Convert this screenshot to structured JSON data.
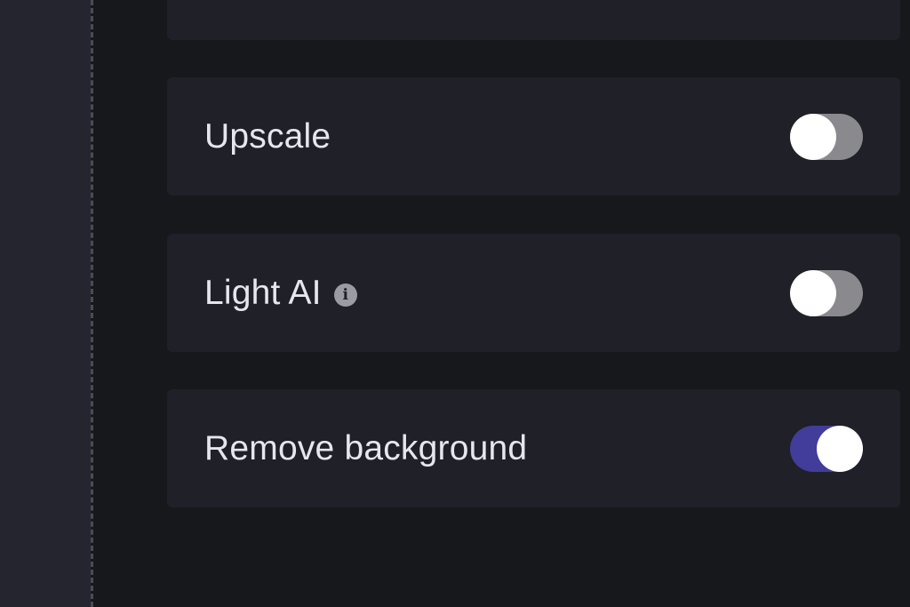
{
  "settings": {
    "items": [
      {
        "label": "Upscale",
        "enabled": false,
        "has_info": false
      },
      {
        "label": "Light AI",
        "enabled": false,
        "has_info": true,
        "info_icon": "info-icon"
      },
      {
        "label": "Remove background",
        "enabled": true,
        "has_info": false
      }
    ]
  },
  "colors": {
    "background": "#17181c",
    "card": "#1f2028",
    "rail": "#24252f",
    "toggle_off": "#8a8a8e",
    "toggle_on": "#423c9a",
    "knob": "#ffffff",
    "label": "#e6e6ec"
  }
}
